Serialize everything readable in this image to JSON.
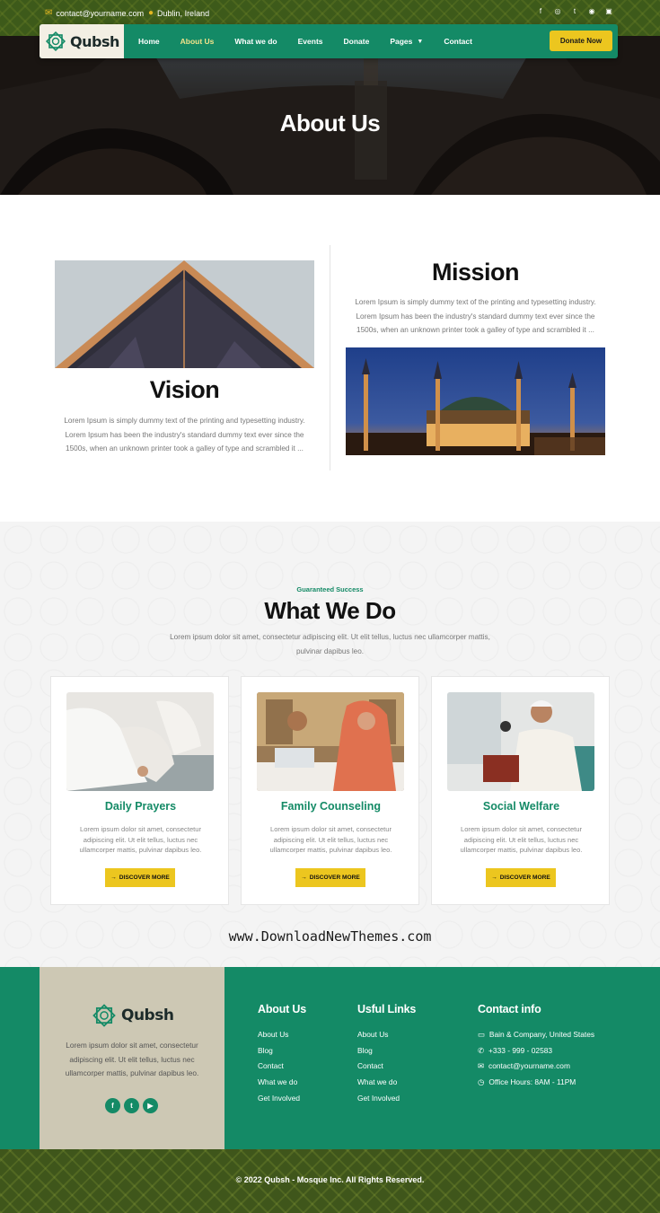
{
  "topbar": {
    "email": "contact@yourname.com",
    "location": "Dublin, Ireland",
    "social": [
      "facebook-icon",
      "instagram-icon",
      "twitter-icon",
      "whatsapp-icon",
      "linkedin-icon"
    ]
  },
  "brand": {
    "name": "Qubsh"
  },
  "nav": {
    "items": [
      "Home",
      "About Us",
      "What we do",
      "Events",
      "Donate",
      "Pages",
      "Contact"
    ],
    "active": "About Us",
    "donate_label": "Donate Now"
  },
  "hero": {
    "title": "About Us"
  },
  "vision": {
    "title": "Vision",
    "text": "Lorem Ipsum is simply dummy text of the printing and typesetting industry. Lorem Ipsum has been the industry's standard dummy text ever since the 1500s, when an unknown printer took a galley of type and scrambled it ..."
  },
  "mission": {
    "title": "Mission",
    "text": "Lorem Ipsum is simply dummy text of the printing and typesetting industry. Lorem Ipsum has been the industry's standard dummy text ever since the 1500s, when an unknown printer took a galley of type and scrambled it ..."
  },
  "services": {
    "kicker": "Guaranteed Success",
    "title": "What We Do",
    "intro": "Lorem ipsum dolor sit amet, consectetur adipiscing elit. Ut elit tellus, luctus nec ullamcorper mattis, pulvinar dapibus leo.",
    "cards": [
      {
        "title": "Daily Prayers",
        "text": "Lorem ipsum dolor sit amet, consectetur adipiscing elit. Ut elit tellus, luctus nec ullamcorper mattis, pulvinar dapibus leo.",
        "button": "DISCOVER MORE"
      },
      {
        "title": "Family Counseling",
        "text": "Lorem ipsum dolor sit amet, consectetur adipiscing elit. Ut elit tellus, luctus nec ullamcorper mattis, pulvinar dapibus leo.",
        "button": "DISCOVER MORE"
      },
      {
        "title": "Social Welfare",
        "text": "Lorem ipsum dolor sit amet, consectetur adipiscing elit. Ut elit tellus, luctus nec ullamcorper mattis, pulvinar dapibus leo.",
        "button": "DISCOVER MORE"
      }
    ],
    "watermark": "www.DownloadNewThemes.com"
  },
  "footer": {
    "about_text": "Lorem ipsum dolor sit amet, consectetur adipiscing elit. Ut elit tellus, luctus nec ullamcorper mattis, pulvinar dapibus leo.",
    "col1": {
      "title": "About Us",
      "links": [
        "About Us",
        "Blog",
        "Contact",
        "What we do",
        "Get Involved"
      ]
    },
    "col2": {
      "title": "Usful Links",
      "links": [
        "About Us",
        "Blog",
        "Contact",
        "What we do",
        "Get Involved"
      ]
    },
    "contact": {
      "title": "Contact info",
      "items": [
        {
          "icon": "map-icon",
          "text": "Bain & Company, United States"
        },
        {
          "icon": "phone-icon",
          "text": "+333 - 999 - 02583"
        },
        {
          "icon": "mail-icon",
          "text": "contact@yourname.com"
        },
        {
          "icon": "clock-icon",
          "text": "Office Hours: 8AM - 11PM"
        }
      ]
    },
    "social": [
      "facebook-icon",
      "twitter-icon",
      "youtube-icon"
    ],
    "copyright": "© 2022 Qubsh - Mosque Inc. All Rights Reserved."
  },
  "colors": {
    "primary": "#148a66",
    "accent": "#ecc61f",
    "olive": "#3f561b",
    "sand": "#cdc8b4"
  }
}
